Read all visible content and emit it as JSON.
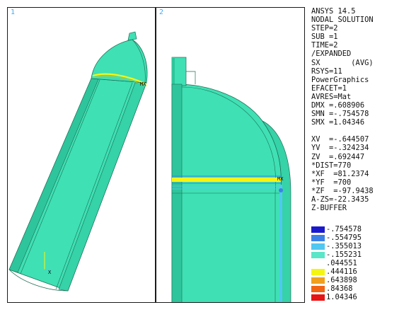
{
  "viewports": [
    {
      "number": "1"
    },
    {
      "number": "2"
    }
  ],
  "info": {
    "software": "ANSYS 14.5",
    "solution": "NODAL SOLUTION",
    "step": "STEP=2",
    "sub": "SUB =1",
    "time": "TIME=2",
    "mode": "/EXPANDED",
    "result": "SX       (AVG)",
    "rsys": "RSYS=11",
    "graphics": "PowerGraphics",
    "efacet": "EFACET=1",
    "avres": "AVRES=Mat",
    "dmx": "DMX =.608906",
    "smn": "SMN =-.754578",
    "smx": "SMX =1.04346",
    "xv": "XV  =-.644507",
    "yv": "YV  =-.324234",
    "zv": "ZV  =.692447",
    "dist": "*DIST=770",
    "xf": "*XF  =81.2374",
    "yf": "*YF  =700",
    "zf": "*ZF  =-97.9438",
    "azs": "A-ZS=-22.3435",
    "buffer": "Z-BUFFER"
  },
  "legend": [
    {
      "value": "-.754578",
      "color": "#1a1acc"
    },
    {
      "value": "-.554795",
      "color": "#3c82e6"
    },
    {
      "value": "-.355013",
      "color": "#50c8f0"
    },
    {
      "value": "-.155231",
      "color": "#5ae6c8"
    },
    {
      "value": ".044551",
      "color": null
    },
    {
      "value": ".444116",
      "color": "#f5f514"
    },
    {
      "value": ".643898",
      "color": "#f0a01e"
    },
    {
      "value": ".84368",
      "color": "#f06414"
    },
    {
      "value": "1.04346",
      "color": "#e61414"
    }
  ],
  "colors": {
    "body": "#3fe0b4",
    "body_dark": "#2fc59c",
    "edge": "#1e6e55",
    "yellow": "#f5f514",
    "blue": "#3c82e6",
    "cyan": "#50c8f0",
    "frame": "#1a1a1a"
  }
}
